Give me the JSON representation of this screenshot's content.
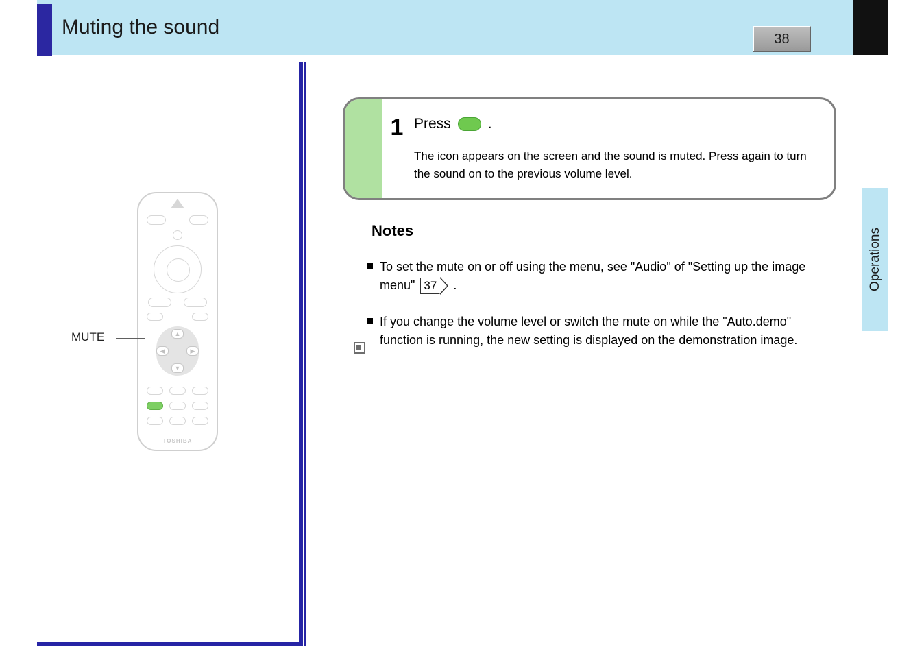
{
  "header": {
    "title": "Muting the sound",
    "page_number": "38"
  },
  "side_tab": "Operations",
  "remote": {
    "brand": "TOSHIBA",
    "button_label": "MUTE"
  },
  "step": {
    "number": "1",
    "action_prefix": "Press",
    "action_suffix": ".",
    "detail": "The icon      appears on the screen and the sound is muted. Press       again to turn the sound on to the previous volume level."
  },
  "notes": {
    "heading": "Notes",
    "items": [
      {
        "text_before": "To set the mute on or off using the menu, see \"Audio\" of \"Setting up the image menu\" ",
        "page_ref": "37",
        "text_after": "."
      },
      {
        "text_before": "If you change the volume level or switch the mute on while the \"Auto.demo\" function is running, the new setting is displayed on the demonstration image.",
        "page_ref": null,
        "text_after": ""
      }
    ]
  }
}
